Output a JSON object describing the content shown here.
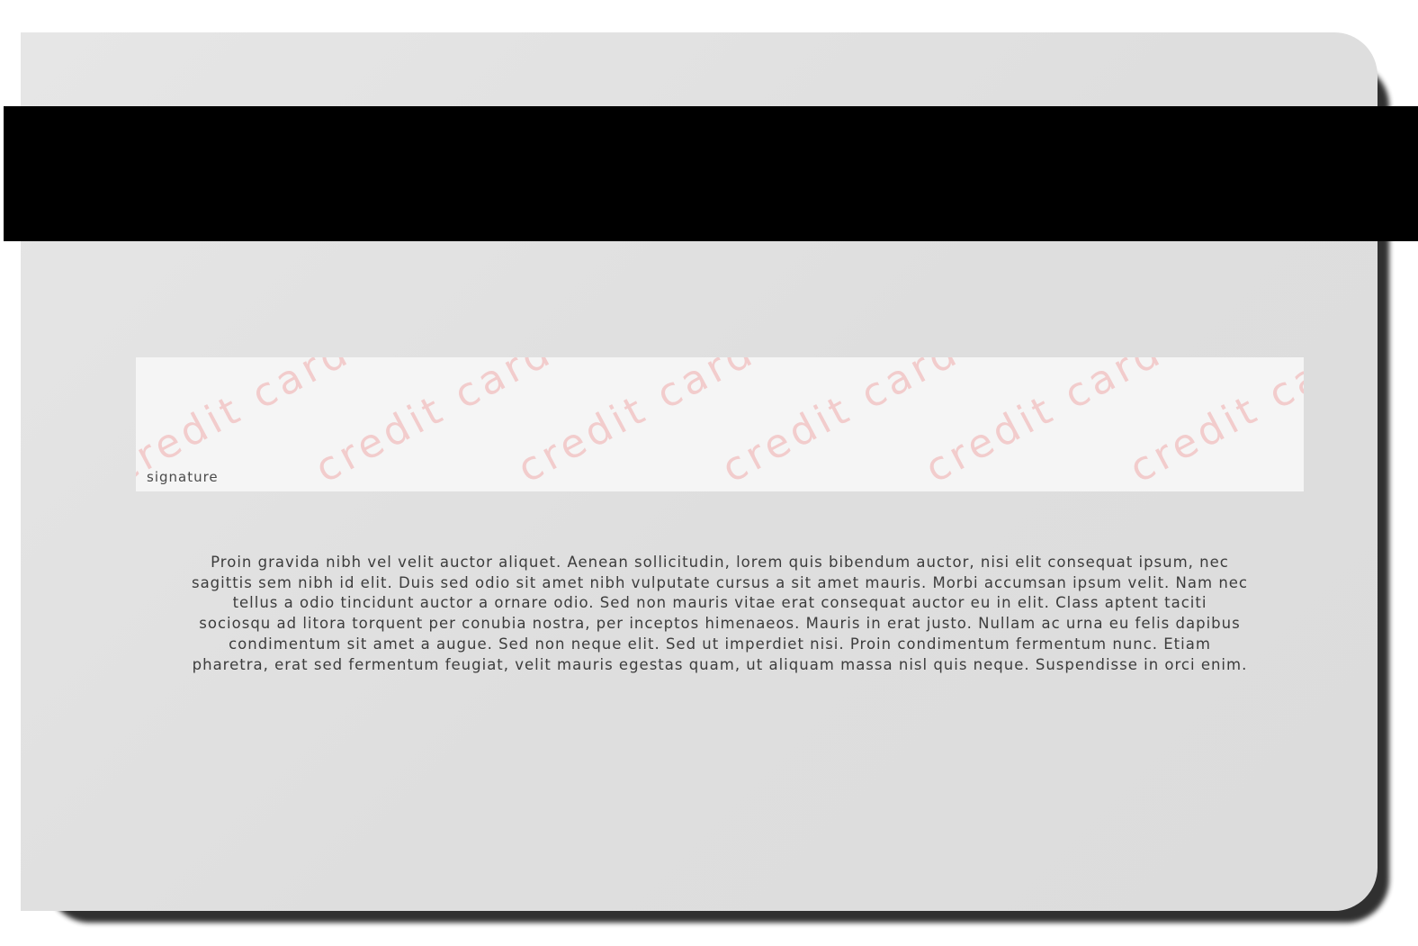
{
  "card": {
    "background_color": "#e0e0e0",
    "stripe_color": "#000000",
    "signature_panel": {
      "label": "signature",
      "watermark_text": "credit card",
      "watermark_color": "#f2cccc",
      "background_color": "#f5f5f5"
    },
    "body_lines": [
      "Proin gravida nibh vel velit auctor aliquet. Aenean sollicitudin, lorem quis bibendum auctor, nisi elit consequat ipsum, nec",
      "sagittis sem nibh id elit. Duis sed odio sit amet nibh vulputate cursus a sit amet mauris. Morbi accumsan ipsum velit. Nam nec",
      "tellus a odio tincidunt auctor a ornare odio. Sed non  mauris vitae erat consequat auctor eu in elit. Class aptent taciti",
      "sociosqu ad litora torquent per conubia nostra, per inceptos himenaeos. Mauris in erat justo. Nullam ac urna eu felis dapibus",
      "condimentum sit amet a augue. Sed non neque elit. Sed ut imperdiet nisi. Proin condimentum fermentum nunc. Etiam",
      "pharetra, erat sed fermentum feugiat, velit mauris egestas quam, ut aliquam massa nisl quis neque. Suspendisse in orci enim."
    ]
  }
}
